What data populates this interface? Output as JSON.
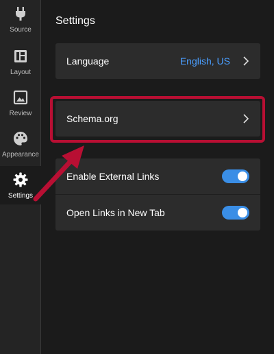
{
  "sidebar": {
    "items": [
      {
        "label": "Source",
        "icon": "plug-icon"
      },
      {
        "label": "Layout",
        "icon": "layout-icon"
      },
      {
        "label": "Review",
        "icon": "image-icon"
      },
      {
        "label": "Appearance",
        "icon": "palette-icon"
      },
      {
        "label": "Settings",
        "icon": "gear-icon",
        "active": true
      }
    ]
  },
  "main": {
    "title": "Settings",
    "language": {
      "label": "Language",
      "value": "English, US"
    },
    "schema": {
      "label": "Schema.org"
    },
    "toggles": [
      {
        "label": "Enable External Links",
        "on": true
      },
      {
        "label": "Open Links in New Tab",
        "on": true
      }
    ]
  },
  "colors": {
    "accent": "#4a9eff",
    "toggle_on": "#3a8ee6",
    "highlight": "#b80f33",
    "background": "#1b1b1b",
    "card": "#2c2c2c"
  }
}
